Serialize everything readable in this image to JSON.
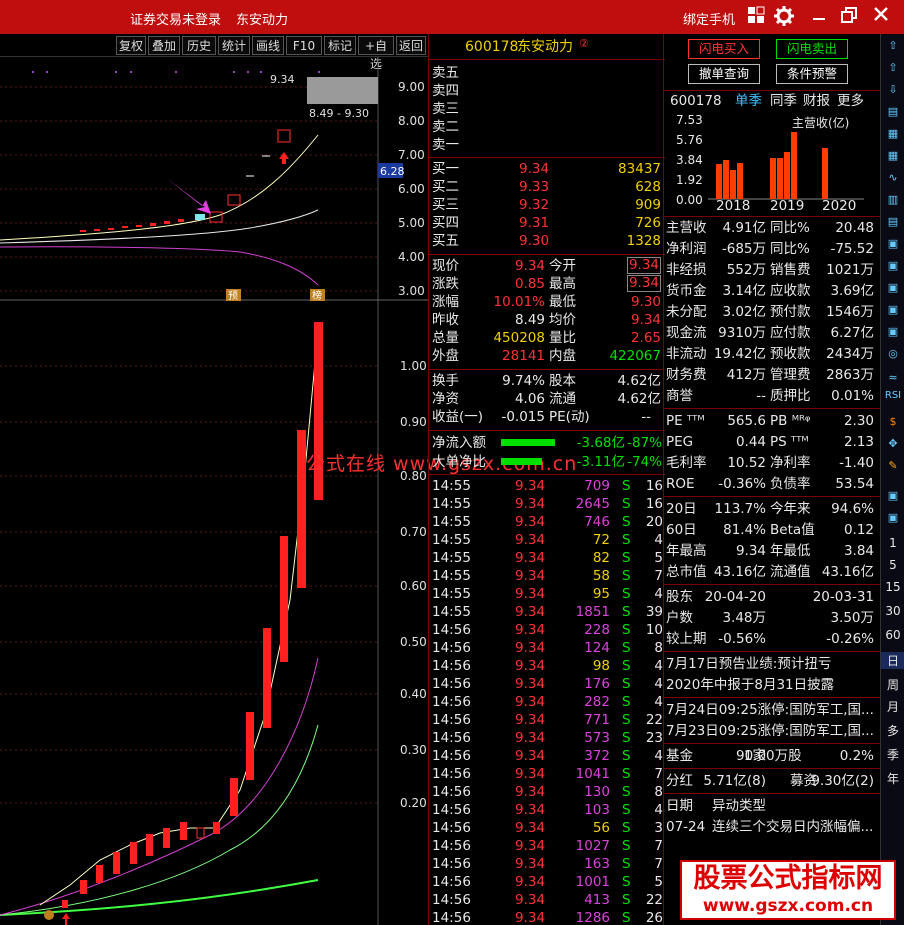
{
  "titlebar": {
    "status": "证券交易未登录",
    "stock_name": "东安动力",
    "bind_phone": "绑定手机"
  },
  "toolbar": {
    "buttons": [
      "复权",
      "叠加",
      "历史",
      "统计",
      "画线",
      "F10",
      "标记",
      "+自选",
      "返回"
    ]
  },
  "kline": {
    "price_axis": [
      "9.00",
      "8.00",
      "7.00",
      "6.00",
      "5.00",
      "4.00",
      "3.00"
    ],
    "last_price_tag": "6.28",
    "range_label": "8.49 - 9.30",
    "high_label": "9.34",
    "marker_pre": "预",
    "marker_list": "榜",
    "lower_axis": [
      "1.00",
      "0.90",
      "0.80",
      "0.70",
      "0.60",
      "0.50",
      "0.40",
      "0.30",
      "0.20"
    ],
    "colors": {
      "up": "#ff2020",
      "ma1": "#ffffc0",
      "ma2": "#e040e0",
      "ma3": "#40ff40"
    }
  },
  "quote": {
    "code": "600178",
    "name": "东安动力",
    "badge": "②",
    "asks": [
      {
        "label": "卖五",
        "price": "",
        "vol": ""
      },
      {
        "label": "卖四",
        "price": "",
        "vol": ""
      },
      {
        "label": "卖三",
        "price": "",
        "vol": ""
      },
      {
        "label": "卖二",
        "price": "",
        "vol": ""
      },
      {
        "label": "卖一",
        "price": "",
        "vol": ""
      }
    ],
    "bids": [
      {
        "label": "买一",
        "price": "9.34",
        "vol": "83437"
      },
      {
        "label": "买二",
        "price": "9.33",
        "vol": "628"
      },
      {
        "label": "买三",
        "price": "9.32",
        "vol": "909"
      },
      {
        "label": "买四",
        "price": "9.31",
        "vol": "726"
      },
      {
        "label": "买五",
        "price": "9.30",
        "vol": "1328"
      }
    ],
    "stats": [
      {
        "l1": "现价",
        "v1": "9.34",
        "l2": "今开",
        "v2": "9.34"
      },
      {
        "l1": "涨跌",
        "v1": "0.85",
        "l2": "最高",
        "v2": "9.34"
      },
      {
        "l1": "涨幅",
        "v1": "10.01%",
        "l2": "最低",
        "v2": "9.30"
      },
      {
        "l1": "昨收",
        "v1": "8.49",
        "l2": "均价",
        "v2": "9.34"
      },
      {
        "l1": "总量",
        "v1": "450208",
        "l2": "量比",
        "v2": "2.65"
      },
      {
        "l1": "外盘",
        "v1": "28141",
        "l2": "内盘",
        "v2": "422067"
      }
    ],
    "stats2": [
      {
        "l1": "换手",
        "v1": "9.74%",
        "l2": "股本",
        "v2": "4.62亿"
      },
      {
        "l1": "净资",
        "v1": "4.06",
        "l2": "流通",
        "v2": "4.62亿"
      },
      {
        "l1": "收益(一)",
        "v1": "-0.015",
        "l2": "PE(动)",
        "v2": "--"
      }
    ],
    "netflow": [
      {
        "label": "净流入额",
        "value": "-3.68亿",
        "pct": "-87%",
        "fill": 0.6
      },
      {
        "label": "大单净比",
        "value": "-3.11亿",
        "pct": "-74%",
        "fill": 0.45
      }
    ],
    "ticks": [
      {
        "t": "14:55",
        "p": "9.34",
        "v": "709",
        "s": "S",
        "n": "16"
      },
      {
        "t": "14:55",
        "p": "9.34",
        "v": "2645",
        "s": "S",
        "n": "16"
      },
      {
        "t": "14:55",
        "p": "9.34",
        "v": "746",
        "s": "S",
        "n": "20"
      },
      {
        "t": "14:55",
        "p": "9.34",
        "v": "72",
        "s": "S",
        "n": "4"
      },
      {
        "t": "14:55",
        "p": "9.34",
        "v": "82",
        "s": "S",
        "n": "5"
      },
      {
        "t": "14:55",
        "p": "9.34",
        "v": "58",
        "s": "S",
        "n": "7"
      },
      {
        "t": "14:55",
        "p": "9.34",
        "v": "95",
        "s": "S",
        "n": "4"
      },
      {
        "t": "14:55",
        "p": "9.34",
        "v": "1851",
        "s": "S",
        "n": "39"
      },
      {
        "t": "14:56",
        "p": "9.34",
        "v": "228",
        "s": "S",
        "n": "10"
      },
      {
        "t": "14:56",
        "p": "9.34",
        "v": "124",
        "s": "S",
        "n": "8"
      },
      {
        "t": "14:56",
        "p": "9.34",
        "v": "98",
        "s": "S",
        "n": "4"
      },
      {
        "t": "14:56",
        "p": "9.34",
        "v": "176",
        "s": "S",
        "n": "4"
      },
      {
        "t": "14:56",
        "p": "9.34",
        "v": "282",
        "s": "S",
        "n": "4"
      },
      {
        "t": "14:56",
        "p": "9.34",
        "v": "771",
        "s": "S",
        "n": "22"
      },
      {
        "t": "14:56",
        "p": "9.34",
        "v": "573",
        "s": "S",
        "n": "23"
      },
      {
        "t": "14:56",
        "p": "9.34",
        "v": "372",
        "s": "S",
        "n": "4"
      },
      {
        "t": "14:56",
        "p": "9.34",
        "v": "1041",
        "s": "S",
        "n": "7"
      },
      {
        "t": "14:56",
        "p": "9.34",
        "v": "130",
        "s": "S",
        "n": "8"
      },
      {
        "t": "14:56",
        "p": "9.34",
        "v": "103",
        "s": "S",
        "n": "4"
      },
      {
        "t": "14:56",
        "p": "9.34",
        "v": "56",
        "s": "S",
        "n": "3"
      },
      {
        "t": "14:56",
        "p": "9.34",
        "v": "1027",
        "s": "S",
        "n": "7"
      },
      {
        "t": "14:56",
        "p": "9.34",
        "v": "163",
        "s": "S",
        "n": "7"
      },
      {
        "t": "14:56",
        "p": "9.34",
        "v": "1001",
        "s": "S",
        "n": "5"
      },
      {
        "t": "14:56",
        "p": "9.34",
        "v": "413",
        "s": "S",
        "n": "22"
      },
      {
        "t": "14:56",
        "p": "9.34",
        "v": "1286",
        "s": "S",
        "n": "26"
      }
    ]
  },
  "right": {
    "btn_flash_buy": "闪电买入",
    "btn_flash_sell": "闪电卖出",
    "btn_cancel": "撤单查询",
    "btn_cond": "条件预警",
    "fin_code": "600178",
    "fin_tabs": [
      "单季",
      "同季",
      "财报",
      "更多"
    ],
    "rev_axis": [
      "7.53",
      "5.76",
      "3.84",
      "1.92",
      "0.00"
    ],
    "rev_title": "主营收(亿)",
    "rev_years": [
      "2018",
      "2019",
      "2020"
    ],
    "fin_rows": [
      {
        "a": "主营收",
        "b": "4.91亿",
        "c": "同比%",
        "d": "20.48"
      },
      {
        "a": "净利润",
        "b": "-685万",
        "c": "同比%",
        "d": "-75.52"
      },
      {
        "a": "非经损",
        "b": "552万",
        "c": "销售费",
        "d": "1021万"
      },
      {
        "a": "货币金",
        "b": "3.14亿",
        "c": "应收款",
        "d": "3.69亿"
      },
      {
        "a": "未分配",
        "b": "3.02亿",
        "c": "预付款",
        "d": "1546万"
      },
      {
        "a": "现金流",
        "b": "9310万",
        "c": "应付款",
        "d": "6.27亿"
      },
      {
        "a": "非流动",
        "b": "19.42亿",
        "c": "预收款",
        "d": "2434万"
      },
      {
        "a": "财务费",
        "b": "412万",
        "c": "管理费",
        "d": "2863万"
      },
      {
        "a": "商誉",
        "b": "--",
        "c": "质押比",
        "d": "0.01%"
      }
    ],
    "val_rows": [
      {
        "a": "PE ᵀᵀᴹ",
        "b": "565.6",
        "c": "PB ᴹᴿᵠ",
        "d": "2.30"
      },
      {
        "a": "PEG",
        "b": "0.44",
        "c": "PS ᵀᵀᴹ",
        "d": "2.13"
      },
      {
        "a": "毛利率",
        "b": "10.52",
        "c": "净利率",
        "d": "-1.40"
      },
      {
        "a": "ROE",
        "b": "-0.36%",
        "c": "负债率",
        "d": "53.54"
      }
    ],
    "perf_rows": [
      {
        "a": "20日",
        "b": "113.7%",
        "c": "今年来",
        "d": "94.6%"
      },
      {
        "a": "60日",
        "b": "81.4%",
        "c": "Beta值",
        "d": "0.12"
      },
      {
        "a": "年最高",
        "b": "9.34",
        "c": "年最低",
        "d": "3.84"
      },
      {
        "a": "总市值",
        "b": "43.16亿",
        "c": "流通值",
        "d": "43.16亿"
      }
    ],
    "holder_rows": [
      {
        "a": "股东",
        "b": "20-04-20",
        "c": "",
        "d": "20-03-31"
      },
      {
        "a": "户数",
        "b": "3.48万",
        "c": "",
        "d": "3.50万"
      },
      {
        "a": "较上期",
        "b": "-0.56%",
        "c": "",
        "d": "-0.26%"
      }
    ],
    "notices": [
      "7月17日预告业绩:预计扭亏",
      "2020年中报于8月31日披露"
    ],
    "news": [
      "7月24日09:25涨停:国防军工,国...",
      "7月23日09:25涨停:国防军工,国..."
    ],
    "fund": {
      "a": "基金",
      "b": "1家",
      "c": "90.00万股",
      "d": "0.2%"
    },
    "dividend": {
      "a": "分红",
      "b": "5.71亿(8)",
      "c": "募资",
      "d": "9.30亿(2)"
    },
    "anomaly_header": {
      "a": "日期",
      "b": "异动类型"
    },
    "anomaly_row": {
      "a": "07-24",
      "b": "连续三个交易日内涨幅偏..."
    }
  },
  "sidebar": {
    "labels": [
      "RSI",
      "1",
      "5",
      "15",
      "30",
      "60",
      "日",
      "周",
      "月",
      "多",
      "季",
      "年"
    ]
  },
  "watermark": "公式在线 www.gszx.com.cn",
  "logo": {
    "main": "股票公式指标网",
    "url": "www.gszx.com.cn"
  }
}
